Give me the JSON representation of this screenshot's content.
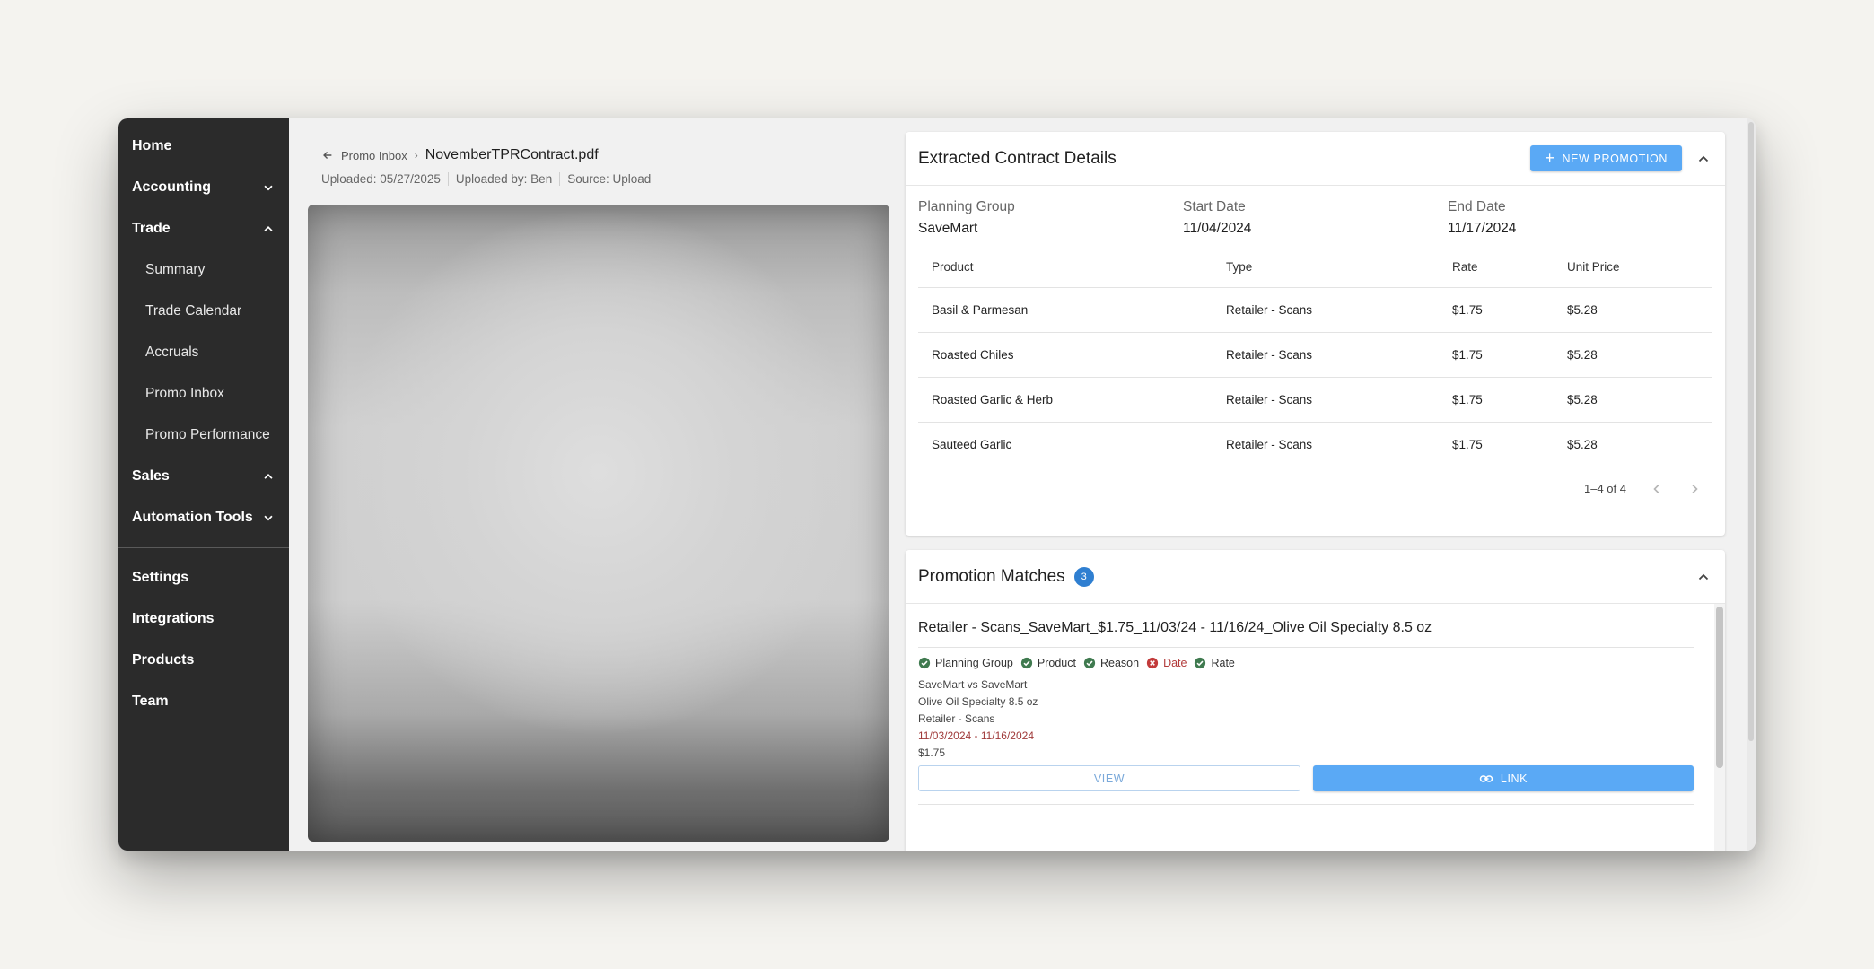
{
  "sidebar": {
    "items": [
      {
        "label": "Home"
      },
      {
        "label": "Accounting",
        "chevron": "down"
      },
      {
        "label": "Trade",
        "chevron": "up"
      },
      {
        "label": "Summary"
      },
      {
        "label": "Trade Calendar"
      },
      {
        "label": "Accruals"
      },
      {
        "label": "Promo Inbox"
      },
      {
        "label": "Promo Performance"
      },
      {
        "label": "Sales",
        "chevron": "up"
      },
      {
        "label": "Automation Tools",
        "chevron": "down"
      }
    ],
    "bottom": [
      {
        "label": "Settings"
      },
      {
        "label": "Integrations"
      },
      {
        "label": "Products"
      },
      {
        "label": "Team"
      }
    ]
  },
  "document": {
    "back_label": "Promo Inbox",
    "file_name": "NovemberTPRContract.pdf",
    "uploaded": "Uploaded: 05/27/2025",
    "uploaded_by": "Uploaded by: Ben",
    "source": "Source: Upload"
  },
  "extracted": {
    "title": "Extracted Contract Details",
    "new_button": "NEW PROMOTION",
    "planning_group_label": "Planning Group",
    "planning_group": "SaveMart",
    "start_label": "Start Date",
    "start_date": "11/04/2024",
    "end_label": "End Date",
    "end_date": "11/17/2024",
    "columns": [
      "Product",
      "Type",
      "Rate",
      "Unit Price"
    ],
    "rows": [
      [
        "Basil & Parmesan",
        "Retailer - Scans",
        "$1.75",
        "$5.28"
      ],
      [
        "Roasted Chiles",
        "Retailer - Scans",
        "$1.75",
        "$5.28"
      ],
      [
        "Roasted Garlic & Herb",
        "Retailer - Scans",
        "$1.75",
        "$5.28"
      ],
      [
        "Sauteed Garlic",
        "Retailer - Scans",
        "$1.75",
        "$5.28"
      ]
    ],
    "pagination": "1–4 of 4"
  },
  "matches": {
    "title": "Promotion Matches",
    "count": "3",
    "match": {
      "title": "Retailer - Scans_SaveMart_$1.75_11/03/24 - 11/16/24_Olive Oil Specialty 8.5 oz",
      "checks": [
        {
          "label": "Planning Group",
          "ok": true
        },
        {
          "label": "Product",
          "ok": true
        },
        {
          "label": "Reason",
          "ok": true
        },
        {
          "label": "Date",
          "ok": false
        },
        {
          "label": "Rate",
          "ok": true
        }
      ],
      "detail_group": "SaveMart vs SaveMart",
      "detail_product": "Olive Oil Specialty 8.5 oz",
      "detail_reason": "Retailer - Scans",
      "detail_date": "11/03/2024 - 11/16/2024",
      "detail_rate": "$1.75",
      "view_label": "VIEW",
      "link_label": "LINK"
    }
  },
  "colors": {
    "sidebar_bg": "#2b2b2b",
    "primary": "#5aa9f5",
    "badge": "#2f7fd1",
    "ok": "#3f7a4f",
    "bad": "#c23a3a"
  },
  "icons": {
    "back": "arrow-left-icon",
    "chevron_up": "chevron-up-icon",
    "chevron_down": "chevron-down-icon",
    "check": "check-circle-icon",
    "error": "x-circle-icon",
    "link": "link-icon",
    "plus": "plus-icon"
  }
}
